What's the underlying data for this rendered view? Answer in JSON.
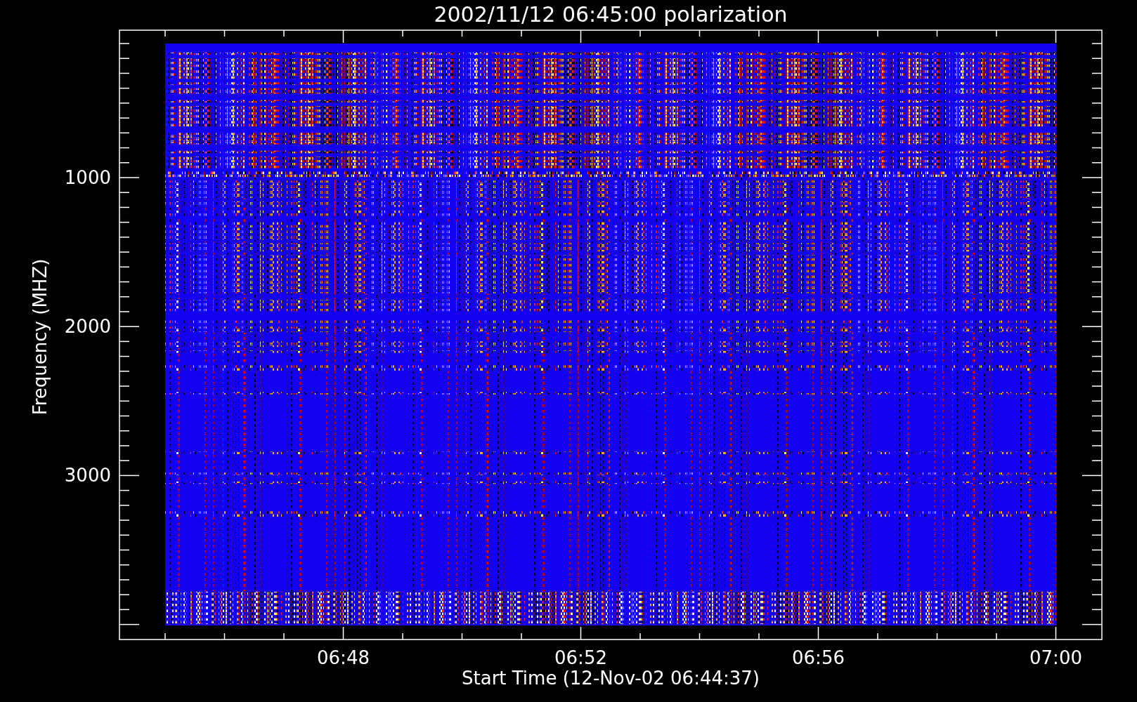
{
  "plot": {
    "title": "2002/11/12 06:45:00 polarization",
    "ylabel": "Frequency (MHZ)",
    "xlabel": "Start Time (12-Nov-02 06:44:37)",
    "yticks": [
      "1000",
      "2000",
      "3000"
    ],
    "xticks": [
      "06:48",
      "06:52",
      "06:56",
      "07:00"
    ]
  }
}
